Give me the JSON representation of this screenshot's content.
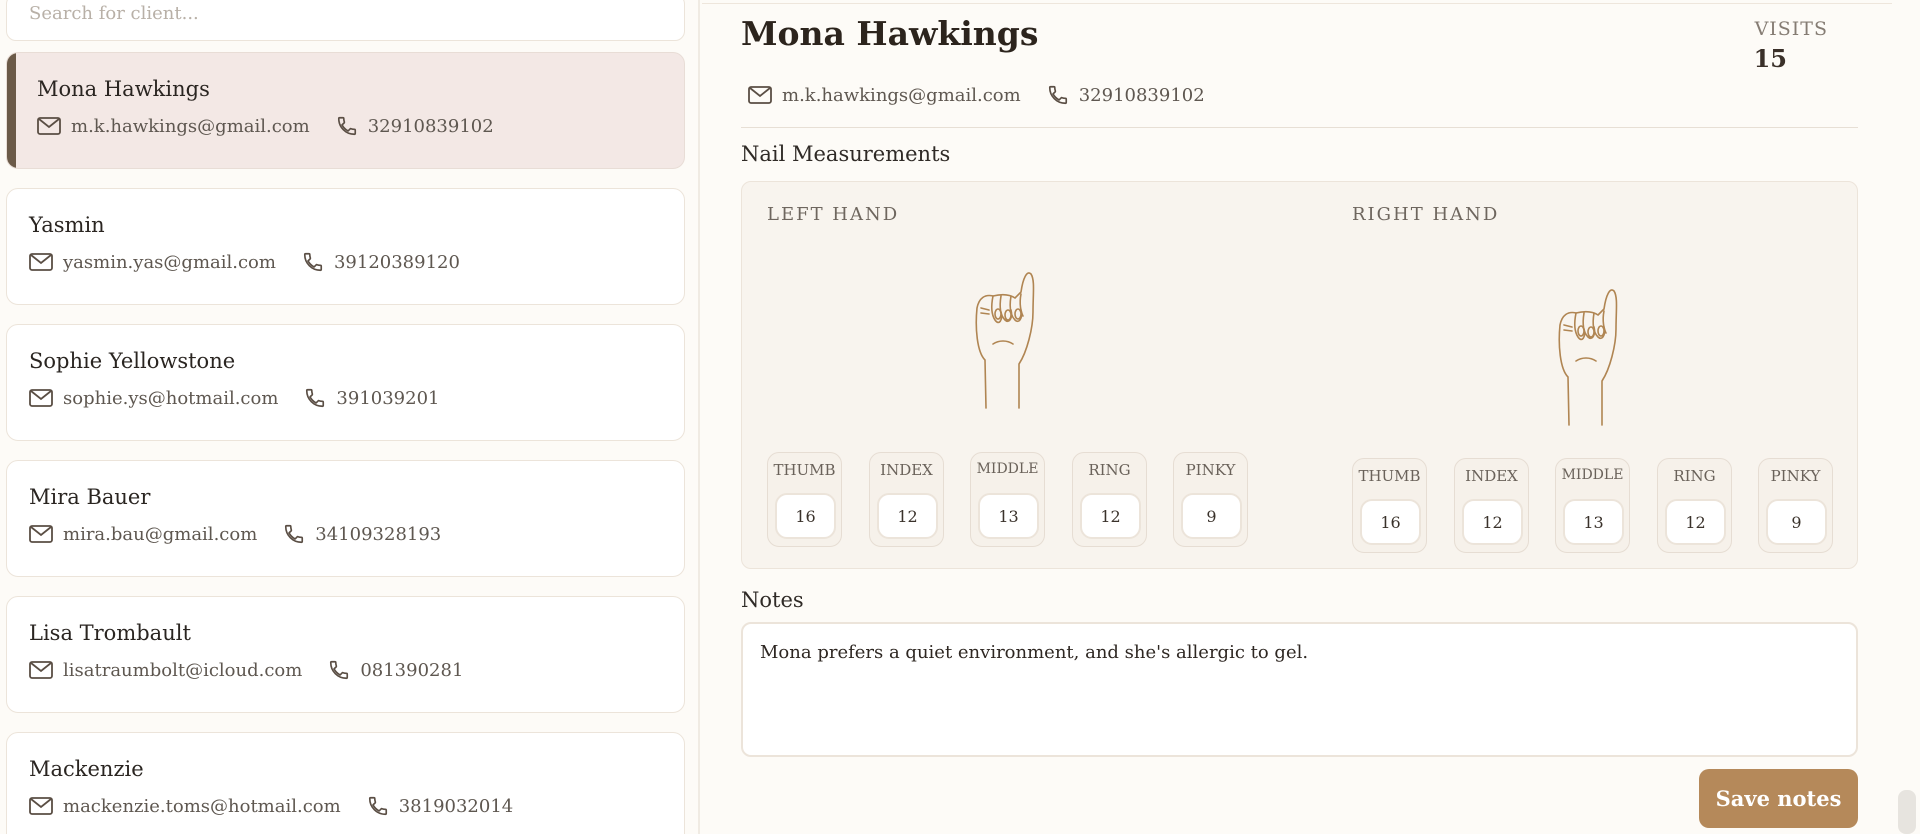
{
  "search": {
    "placeholder": "Search for client..."
  },
  "clients": [
    {
      "name": "Mona Hawkings",
      "email": "m.k.hawkings@gmail.com",
      "phone": "32910839102",
      "active": true
    },
    {
      "name": "Yasmin",
      "email": "yasmin.yas@gmail.com",
      "phone": "39120389120"
    },
    {
      "name": "Sophie Yellowstone",
      "email": "sophie.ys@hotmail.com",
      "phone": "391039201"
    },
    {
      "name": "Mira Bauer",
      "email": "mira.bau@gmail.com",
      "phone": "34109328193"
    },
    {
      "name": "Lisa Trombault",
      "email": "lisatraumbolt@icloud.com",
      "phone": "081390281"
    },
    {
      "name": "Mackenzie",
      "email": "mackenzie.toms@hotmail.com",
      "phone": "3819032014"
    }
  ],
  "detail": {
    "name": "Mona Hawkings",
    "email": "m.k.hawkings@gmail.com",
    "phone": "32910839102",
    "visits_label": "VISITS",
    "visits_value": "15",
    "measurements_title": "Nail Measurements",
    "left_hand": {
      "label": "LEFT HAND",
      "fingers": [
        {
          "label": "THUMB",
          "value": "16"
        },
        {
          "label": "INDEX",
          "value": "12"
        },
        {
          "label": "MIDDLE",
          "value": "13"
        },
        {
          "label": "RING",
          "value": "12"
        },
        {
          "label": "PINKY",
          "value": "9"
        }
      ]
    },
    "right_hand": {
      "label": "RIGHT HAND",
      "fingers": [
        {
          "label": "THUMB",
          "value": "16"
        },
        {
          "label": "INDEX",
          "value": "12"
        },
        {
          "label": "MIDDLE",
          "value": "13"
        },
        {
          "label": "RING",
          "value": "12"
        },
        {
          "label": "PINKY",
          "value": "9"
        }
      ]
    },
    "notes_title": "Notes",
    "notes_text": "Mona prefers a quiet environment, and she's allergic to gel.",
    "save_label": "Save notes"
  },
  "colors": {
    "accent": "#b5895a",
    "active_bar": "#6b5a48",
    "active_card_bg": "#f3e8e5",
    "illustration": "#b08552"
  },
  "icons": {
    "email": "mail-icon",
    "phone": "phone-icon",
    "hand": "raised-fist-icon"
  }
}
